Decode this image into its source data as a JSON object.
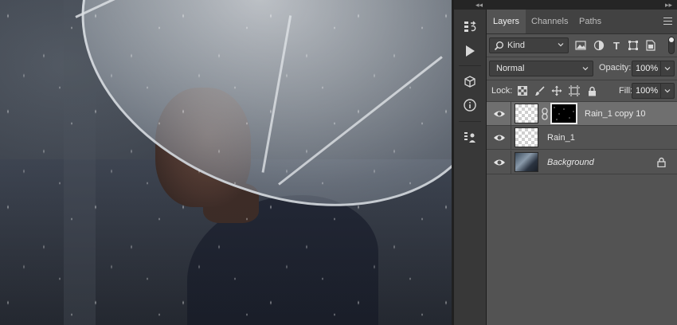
{
  "panel": {
    "tabs": [
      {
        "label": "Layers"
      },
      {
        "label": "Channels"
      },
      {
        "label": "Paths"
      }
    ],
    "filter": {
      "kind_label": "Kind"
    },
    "blend_mode": "Normal",
    "opacity": {
      "label": "Opacity:",
      "value": "100%"
    },
    "lock": {
      "label": "Lock:"
    },
    "fill": {
      "label": "Fill:",
      "value": "100%"
    },
    "layers": [
      {
        "name": "Rain_1 copy 10",
        "selected": true,
        "has_mask": true,
        "thumb": "transparent"
      },
      {
        "name": "Rain_1",
        "selected": false,
        "has_mask": false,
        "thumb": "transparent"
      },
      {
        "name": "Background",
        "selected": false,
        "has_mask": false,
        "thumb": "photo",
        "locked": true
      }
    ]
  },
  "toolstrip": {
    "icons": [
      "history-icon",
      "play-action-icon",
      "3d-cube-icon",
      "info-icon",
      "properties-icon"
    ]
  },
  "colors": {
    "panel_bg": "#535353",
    "selected_row": "#6f6f6f",
    "tab_bar": "#424242"
  }
}
